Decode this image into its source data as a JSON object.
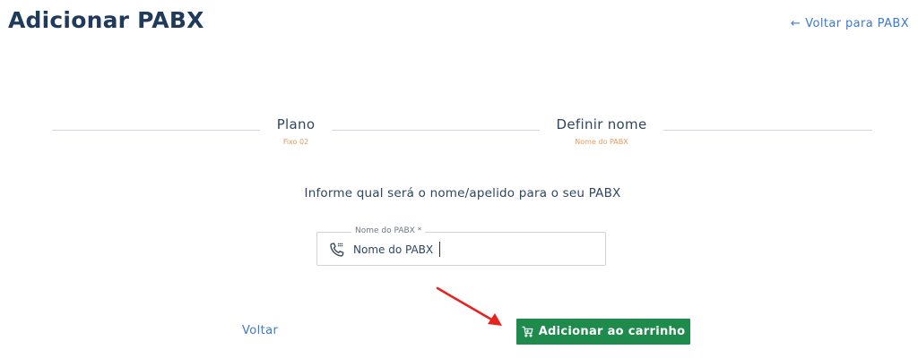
{
  "header": {
    "title": "Adicionar PABX",
    "back_link_arrow": "←",
    "back_link_label": "Voltar para PABX"
  },
  "stepper": {
    "steps": [
      {
        "title": "Plano",
        "subtitle": "Fixo 02"
      },
      {
        "title": "Definir nome",
        "subtitle": "Nome do PABX"
      }
    ]
  },
  "form": {
    "instruction": "Informe qual será o nome/apelido para o seu PABX",
    "name_field": {
      "label": "Nome do PABX *",
      "value": "Nome do PABX",
      "icon": "phone-icon"
    }
  },
  "actions": {
    "back_label": "Voltar",
    "add_to_cart_label": "Adicionar ao carrinho",
    "add_to_cart_icon": "cart-icon"
  },
  "annotation": {
    "arrow_color": "#e8231f"
  },
  "colors": {
    "title": "#1f3a5a",
    "link": "#3b7ad1",
    "step_subtitle": "#e89a5a",
    "primary_button": "#1e8a4c"
  }
}
